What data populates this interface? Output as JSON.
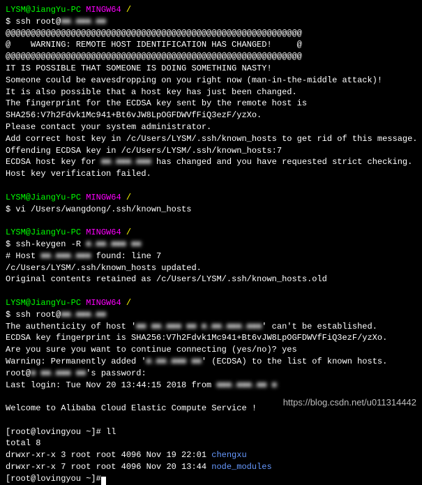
{
  "colors": {
    "user": "#00ff00",
    "host": "#ff00ff",
    "path": "#ffff00",
    "dir": "#6699ff"
  },
  "prompt": {
    "user_host": "LYSM@JiangYu-PC",
    "shell": "MINGW64",
    "path": "/"
  },
  "blurred": {
    "ip1": "■■.■■■.■■",
    "ip2": "■.■■.■■■ ■■",
    "ip3": "■■.■■■.■■■",
    "host_long": "■■ ■■.■■■ ■■ ■.■■.■■■.■■■",
    "added_host": "■.■■.■■■ ■■",
    "root_at": "■ ■■.■■■ ■■",
    "last_from": "■■■.■■■.■■ ■"
  },
  "block1": {
    "cmd": "$ ssh root@",
    "at_line": "@@@@@@@@@@@@@@@@@@@@@@@@@@@@@@@@@@@@@@@@@@@@@@@@@@@@@@@@@@@",
    "warn1": "@    WARNING: REMOTE HOST IDENTIFICATION HAS CHANGED!     @",
    "l1": "IT IS POSSIBLE THAT SOMEONE IS DOING SOMETHING NASTY!",
    "l2": "Someone could be eavesdropping on you right now (man-in-the-middle attack)!",
    "l3": "It is also possible that a host key has just been changed.",
    "l4": "The fingerprint for the ECDSA key sent by the remote host is",
    "l5": "SHA256:V7h2Fdvk1Mc941+Bt6vJW8LpOGFDWVfFiQ3ezF/yzXo.",
    "l6": "Please contact your system administrator.",
    "l7": "Add correct host key in /c/Users/LYSM/.ssh/known_hosts to get rid of this message.",
    "l8": "Offending ECDSA key in /c/Users/LYSM/.ssh/known_hosts:7",
    "l9a": "ECDSA host key for ",
    "l9b": " has changed and you have requested strict checking.",
    "l10": "Host key verification failed."
  },
  "block2": {
    "cmd": "$ vi /Users/wangdong/.ssh/known_hosts"
  },
  "block3": {
    "cmd": "$ ssh-keygen -R ",
    "l1a": "# Host ",
    "l1b": " found: line 7",
    "l2": "/c/Users/LYSM/.ssh/known_hosts updated.",
    "l3": "Original contents retained as /c/Users/LYSM/.ssh/known_hosts.old"
  },
  "block4": {
    "cmd": "$ ssh root@",
    "l1a": "The authenticity of host '",
    "l1b": "' can't be established.",
    "l2": "ECDSA key fingerprint is SHA256:V7h2Fdvk1Mc941+Bt6vJW8LpOGFDWVfFiQ3ezF/yzXo.",
    "l3": "Are you sure you want to continue connecting (yes/no)? yes",
    "l4a": "Warning: Permanently added '",
    "l4b": "' (ECDSA) to the list of known hosts.",
    "l5a": "root@",
    "l5b": "'s password:",
    "l6a": "Last login: Tue Nov 20 13:44:15 2018 from ",
    "welcome": "Welcome to Alibaba Cloud Elastic Compute Service !"
  },
  "server": {
    "prompt": "[root@lovingyou ~]#",
    "ll_cmd": " ll",
    "total": "total 8",
    "row1_perm": "drwxr-xr-x 3 root root 4096 Nov 19 22:01 ",
    "row1_name": "chengxu",
    "row2_perm": "drwxr-xr-x 7 root root 4096 Nov 20 13:44 ",
    "row2_name": "node_modules"
  },
  "watermark": "https://blog.csdn.net/u011314442"
}
